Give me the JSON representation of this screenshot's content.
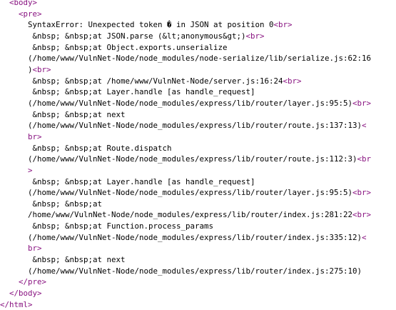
{
  "colors": {
    "background": "#ffffff",
    "tag": "#881280",
    "text": "#000000"
  },
  "source_lines": [
    {
      "indent": 2,
      "parts": [
        {
          "kind": "tag",
          "text": "<body>"
        }
      ]
    },
    {
      "indent": 4,
      "parts": [
        {
          "kind": "tag",
          "text": "<pre>"
        }
      ]
    },
    {
      "indent": 6,
      "parts": [
        {
          "kind": "text",
          "text": "SyntaxError: Unexpected token � in JSON at position 0"
        },
        {
          "kind": "tag",
          "text": "<br>"
        }
      ]
    },
    {
      "indent": 7,
      "parts": [
        {
          "kind": "text",
          "text": "&nbsp; &nbsp;at JSON.parse (&lt;anonymous&gt;)"
        },
        {
          "kind": "tag",
          "text": "<br>"
        }
      ]
    },
    {
      "indent": 7,
      "parts": [
        {
          "kind": "text",
          "text": "&nbsp; &nbsp;at Object.exports.unserialize"
        }
      ]
    },
    {
      "indent": 6,
      "parts": [
        {
          "kind": "text",
          "text": "(/home/www/VulnNet-Node/node_modules/node-serialize/lib/serialize.js:62:16"
        }
      ]
    },
    {
      "indent": 6,
      "parts": [
        {
          "kind": "text",
          "text": ")"
        },
        {
          "kind": "tag",
          "text": "<br>"
        }
      ]
    },
    {
      "indent": 7,
      "parts": [
        {
          "kind": "text",
          "text": "&nbsp; &nbsp;at /home/www/VulnNet-Node/server.js:16:24"
        },
        {
          "kind": "tag",
          "text": "<br>"
        }
      ]
    },
    {
      "indent": 7,
      "parts": [
        {
          "kind": "text",
          "text": "&nbsp; &nbsp;at Layer.handle [as handle_request]"
        }
      ]
    },
    {
      "indent": 6,
      "parts": [
        {
          "kind": "text",
          "text": "(/home/www/VulnNet-Node/node_modules/express/lib/router/layer.js:95:5)"
        },
        {
          "kind": "tag",
          "text": "<br>"
        }
      ]
    },
    {
      "indent": 7,
      "parts": [
        {
          "kind": "text",
          "text": "&nbsp; &nbsp;at next"
        }
      ]
    },
    {
      "indent": 6,
      "parts": [
        {
          "kind": "text",
          "text": "(/home/www/VulnNet-Node/node_modules/express/lib/router/route.js:137:13)"
        },
        {
          "kind": "tag",
          "text": "<"
        }
      ]
    },
    {
      "indent": 6,
      "parts": [
        {
          "kind": "tag",
          "text": "br>"
        }
      ]
    },
    {
      "indent": 7,
      "parts": [
        {
          "kind": "text",
          "text": "&nbsp; &nbsp;at Route.dispatch"
        }
      ]
    },
    {
      "indent": 6,
      "parts": [
        {
          "kind": "text",
          "text": "(/home/www/VulnNet-Node/node_modules/express/lib/router/route.js:112:3)"
        },
        {
          "kind": "tag",
          "text": "<br"
        }
      ]
    },
    {
      "indent": 6,
      "parts": [
        {
          "kind": "tag",
          "text": ">"
        }
      ]
    },
    {
      "indent": 7,
      "parts": [
        {
          "kind": "text",
          "text": "&nbsp; &nbsp;at Layer.handle [as handle_request]"
        }
      ]
    },
    {
      "indent": 6,
      "parts": [
        {
          "kind": "text",
          "text": "(/home/www/VulnNet-Node/node_modules/express/lib/router/layer.js:95:5)"
        },
        {
          "kind": "tag",
          "text": "<br>"
        }
      ]
    },
    {
      "indent": 7,
      "parts": [
        {
          "kind": "text",
          "text": "&nbsp; &nbsp;at"
        }
      ]
    },
    {
      "indent": 6,
      "parts": [
        {
          "kind": "text",
          "text": "/home/www/VulnNet-Node/node_modules/express/lib/router/index.js:281:22"
        },
        {
          "kind": "tag",
          "text": "<br>"
        }
      ]
    },
    {
      "indent": 7,
      "parts": [
        {
          "kind": "text",
          "text": "&nbsp; &nbsp;at Function.process_params"
        }
      ]
    },
    {
      "indent": 6,
      "parts": [
        {
          "kind": "text",
          "text": "(/home/www/VulnNet-Node/node_modules/express/lib/router/index.js:335:12)"
        },
        {
          "kind": "tag",
          "text": "<"
        }
      ]
    },
    {
      "indent": 6,
      "parts": [
        {
          "kind": "tag",
          "text": "br>"
        }
      ]
    },
    {
      "indent": 7,
      "parts": [
        {
          "kind": "text",
          "text": "&nbsp; &nbsp;at next"
        }
      ]
    },
    {
      "indent": 6,
      "parts": [
        {
          "kind": "text",
          "text": "(/home/www/VulnNet-Node/node_modules/express/lib/router/index.js:275:10)"
        }
      ]
    },
    {
      "indent": 4,
      "parts": [
        {
          "kind": "tag",
          "text": "</pre>"
        }
      ]
    },
    {
      "indent": 2,
      "parts": [
        {
          "kind": "tag",
          "text": "</body>"
        }
      ]
    },
    {
      "indent": 0,
      "parts": [
        {
          "kind": "tag",
          "text": "</html>"
        }
      ]
    }
  ]
}
